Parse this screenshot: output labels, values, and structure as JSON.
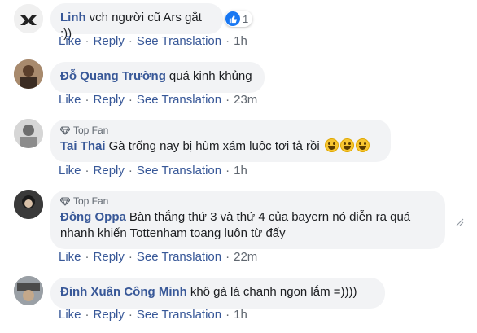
{
  "comments": [
    {
      "name": "Linh",
      "text": "vch người cũ Ars gắt :))",
      "top_fan": "",
      "actions": {
        "like": "Like",
        "reply": "Reply",
        "translate": "See Translation",
        "time": "1h"
      },
      "reaction_count": "1"
    },
    {
      "name": "Đỗ Quang Trường",
      "text": "quá kinh khủng",
      "top_fan": "",
      "actions": {
        "like": "Like",
        "reply": "Reply",
        "translate": "See Translation",
        "time": "23m"
      }
    },
    {
      "name": "Tai Thai",
      "text": "Gà trống nay bị hùm xám luộc tơi tả rồi",
      "top_fan": "Top Fan",
      "actions": {
        "like": "Like",
        "reply": "Reply",
        "translate": "See Translation",
        "time": "1h"
      }
    },
    {
      "name": "Đông Oppa",
      "text": "Bàn thắng thứ 3 và thứ 4 của bayern nó diễn ra quá nhanh khiến Tottenham toang luôn từ đấy",
      "top_fan": "Top Fan",
      "actions": {
        "like": "Like",
        "reply": "Reply",
        "translate": "See Translation",
        "time": "22m"
      }
    },
    {
      "name": "Đinh Xuân Công Minh",
      "text": "khô gà lá chanh ngon lắm =))))",
      "top_fan": "",
      "actions": {
        "like": "Like",
        "reply": "Reply",
        "translate": "See Translation",
        "time": "1h"
      }
    }
  ],
  "colors": {
    "name": "#385898",
    "bubble": "#f2f3f5",
    "meta": "#606770",
    "like": "#1877f2"
  }
}
